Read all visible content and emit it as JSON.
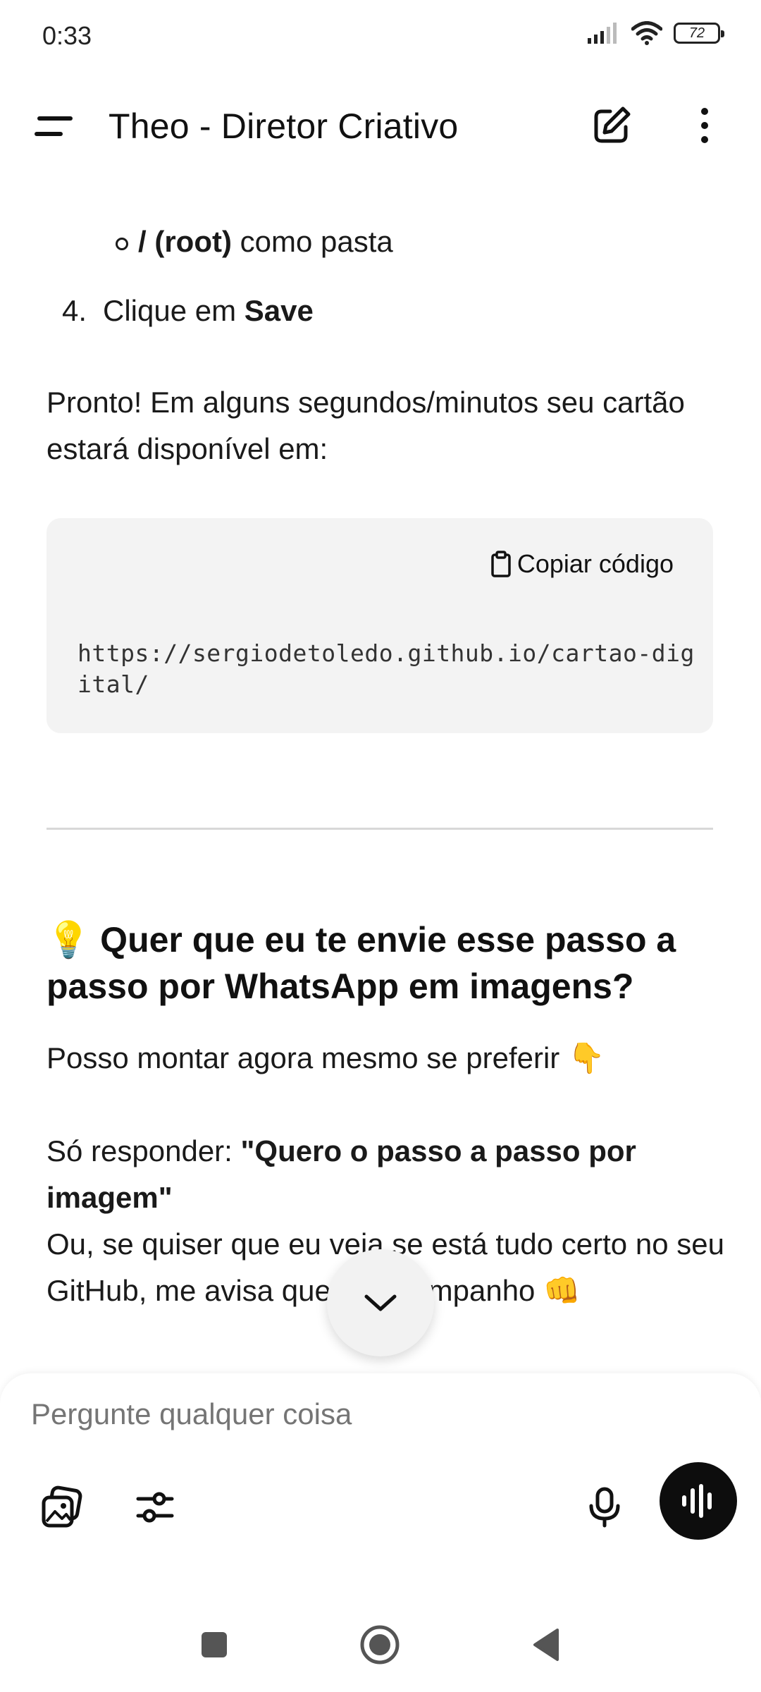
{
  "status_bar": {
    "time": "0:33",
    "battery": "72"
  },
  "header": {
    "title": "Theo - Diretor Criativo",
    "icons": [
      "menu-icon",
      "edit-icon",
      "more-vertical-icon"
    ]
  },
  "message": {
    "sub_bullet": {
      "bold": "/ (root)",
      "text": " como pasta"
    },
    "step": {
      "number": "4.",
      "text": "Clique em ",
      "bold": "Save"
    },
    "paragraph_ready": "Pronto! Em alguns segundos/minutos seu cartão estará disponível em:",
    "code_block": {
      "copy_label": "Copiar código",
      "code": "https://sergiodetoledo.github.io/cartao-digital/"
    },
    "heading_emoji": "💡",
    "heading": "Quer que eu te envie esse passo a passo por WhatsApp em imagens?",
    "paragraph_offer": "Posso montar agora mesmo se preferir",
    "offer_emoji": "👇",
    "reply_prefix": "Só responder: ",
    "reply_bold": "\"Quero o passo a passo por imagem\"",
    "paragraph_check": "Ou, se quiser que eu veja se está tudo certo no seu GitHub, me avisa que eu acompanho",
    "check_emoji": "👊"
  },
  "composer": {
    "placeholder": "Pergunte qualquer coisa"
  },
  "colors": {
    "code_bg": "#f3f3f3",
    "voice_button": "#0d0d0d",
    "divider": "#d8d8d8"
  }
}
